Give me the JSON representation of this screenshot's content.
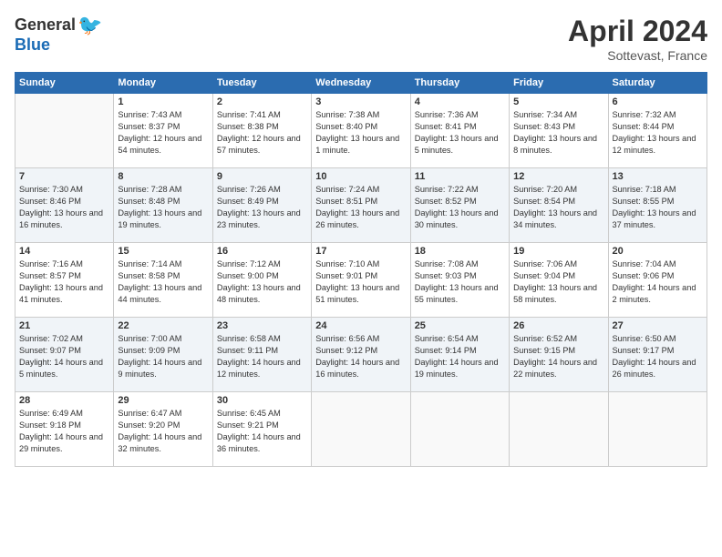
{
  "header": {
    "logo_general": "General",
    "logo_blue": "Blue",
    "title": "April 2024",
    "subtitle": "Sottevast, France"
  },
  "weekdays": [
    "Sunday",
    "Monday",
    "Tuesday",
    "Wednesday",
    "Thursday",
    "Friday",
    "Saturday"
  ],
  "weeks": [
    [
      {
        "day": "",
        "info": ""
      },
      {
        "day": "1",
        "info": "Sunrise: 7:43 AM\nSunset: 8:37 PM\nDaylight: 12 hours\nand 54 minutes."
      },
      {
        "day": "2",
        "info": "Sunrise: 7:41 AM\nSunset: 8:38 PM\nDaylight: 12 hours\nand 57 minutes."
      },
      {
        "day": "3",
        "info": "Sunrise: 7:38 AM\nSunset: 8:40 PM\nDaylight: 13 hours\nand 1 minute."
      },
      {
        "day": "4",
        "info": "Sunrise: 7:36 AM\nSunset: 8:41 PM\nDaylight: 13 hours\nand 5 minutes."
      },
      {
        "day": "5",
        "info": "Sunrise: 7:34 AM\nSunset: 8:43 PM\nDaylight: 13 hours\nand 8 minutes."
      },
      {
        "day": "6",
        "info": "Sunrise: 7:32 AM\nSunset: 8:44 PM\nDaylight: 13 hours\nand 12 minutes."
      }
    ],
    [
      {
        "day": "7",
        "info": "Sunrise: 7:30 AM\nSunset: 8:46 PM\nDaylight: 13 hours\nand 16 minutes."
      },
      {
        "day": "8",
        "info": "Sunrise: 7:28 AM\nSunset: 8:48 PM\nDaylight: 13 hours\nand 19 minutes."
      },
      {
        "day": "9",
        "info": "Sunrise: 7:26 AM\nSunset: 8:49 PM\nDaylight: 13 hours\nand 23 minutes."
      },
      {
        "day": "10",
        "info": "Sunrise: 7:24 AM\nSunset: 8:51 PM\nDaylight: 13 hours\nand 26 minutes."
      },
      {
        "day": "11",
        "info": "Sunrise: 7:22 AM\nSunset: 8:52 PM\nDaylight: 13 hours\nand 30 minutes."
      },
      {
        "day": "12",
        "info": "Sunrise: 7:20 AM\nSunset: 8:54 PM\nDaylight: 13 hours\nand 34 minutes."
      },
      {
        "day": "13",
        "info": "Sunrise: 7:18 AM\nSunset: 8:55 PM\nDaylight: 13 hours\nand 37 minutes."
      }
    ],
    [
      {
        "day": "14",
        "info": "Sunrise: 7:16 AM\nSunset: 8:57 PM\nDaylight: 13 hours\nand 41 minutes."
      },
      {
        "day": "15",
        "info": "Sunrise: 7:14 AM\nSunset: 8:58 PM\nDaylight: 13 hours\nand 44 minutes."
      },
      {
        "day": "16",
        "info": "Sunrise: 7:12 AM\nSunset: 9:00 PM\nDaylight: 13 hours\nand 48 minutes."
      },
      {
        "day": "17",
        "info": "Sunrise: 7:10 AM\nSunset: 9:01 PM\nDaylight: 13 hours\nand 51 minutes."
      },
      {
        "day": "18",
        "info": "Sunrise: 7:08 AM\nSunset: 9:03 PM\nDaylight: 13 hours\nand 55 minutes."
      },
      {
        "day": "19",
        "info": "Sunrise: 7:06 AM\nSunset: 9:04 PM\nDaylight: 13 hours\nand 58 minutes."
      },
      {
        "day": "20",
        "info": "Sunrise: 7:04 AM\nSunset: 9:06 PM\nDaylight: 14 hours\nand 2 minutes."
      }
    ],
    [
      {
        "day": "21",
        "info": "Sunrise: 7:02 AM\nSunset: 9:07 PM\nDaylight: 14 hours\nand 5 minutes."
      },
      {
        "day": "22",
        "info": "Sunrise: 7:00 AM\nSunset: 9:09 PM\nDaylight: 14 hours\nand 9 minutes."
      },
      {
        "day": "23",
        "info": "Sunrise: 6:58 AM\nSunset: 9:11 PM\nDaylight: 14 hours\nand 12 minutes."
      },
      {
        "day": "24",
        "info": "Sunrise: 6:56 AM\nSunset: 9:12 PM\nDaylight: 14 hours\nand 16 minutes."
      },
      {
        "day": "25",
        "info": "Sunrise: 6:54 AM\nSunset: 9:14 PM\nDaylight: 14 hours\nand 19 minutes."
      },
      {
        "day": "26",
        "info": "Sunrise: 6:52 AM\nSunset: 9:15 PM\nDaylight: 14 hours\nand 22 minutes."
      },
      {
        "day": "27",
        "info": "Sunrise: 6:50 AM\nSunset: 9:17 PM\nDaylight: 14 hours\nand 26 minutes."
      }
    ],
    [
      {
        "day": "28",
        "info": "Sunrise: 6:49 AM\nSunset: 9:18 PM\nDaylight: 14 hours\nand 29 minutes."
      },
      {
        "day": "29",
        "info": "Sunrise: 6:47 AM\nSunset: 9:20 PM\nDaylight: 14 hours\nand 32 minutes."
      },
      {
        "day": "30",
        "info": "Sunrise: 6:45 AM\nSunset: 9:21 PM\nDaylight: 14 hours\nand 36 minutes."
      },
      {
        "day": "",
        "info": ""
      },
      {
        "day": "",
        "info": ""
      },
      {
        "day": "",
        "info": ""
      },
      {
        "day": "",
        "info": ""
      }
    ]
  ]
}
